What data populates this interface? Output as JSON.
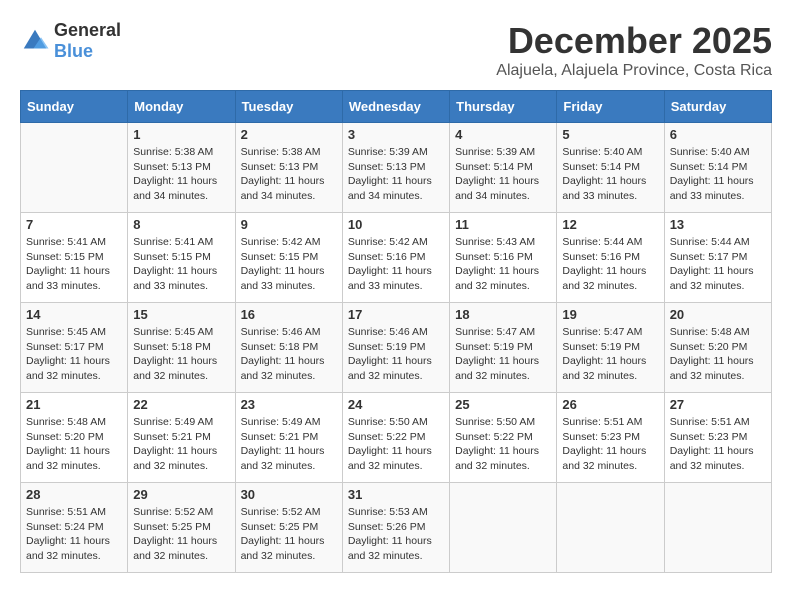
{
  "logo": {
    "text_general": "General",
    "text_blue": "Blue"
  },
  "title": "December 2025",
  "subtitle": "Alajuela, Alajuela Province, Costa Rica",
  "weekdays": [
    "Sunday",
    "Monday",
    "Tuesday",
    "Wednesday",
    "Thursday",
    "Friday",
    "Saturday"
  ],
  "weeks": [
    [
      {
        "day": "",
        "sunrise": "",
        "sunset": "",
        "daylight": ""
      },
      {
        "day": "1",
        "sunrise": "Sunrise: 5:38 AM",
        "sunset": "Sunset: 5:13 PM",
        "daylight": "Daylight: 11 hours and 34 minutes."
      },
      {
        "day": "2",
        "sunrise": "Sunrise: 5:38 AM",
        "sunset": "Sunset: 5:13 PM",
        "daylight": "Daylight: 11 hours and 34 minutes."
      },
      {
        "day": "3",
        "sunrise": "Sunrise: 5:39 AM",
        "sunset": "Sunset: 5:13 PM",
        "daylight": "Daylight: 11 hours and 34 minutes."
      },
      {
        "day": "4",
        "sunrise": "Sunrise: 5:39 AM",
        "sunset": "Sunset: 5:14 PM",
        "daylight": "Daylight: 11 hours and 34 minutes."
      },
      {
        "day": "5",
        "sunrise": "Sunrise: 5:40 AM",
        "sunset": "Sunset: 5:14 PM",
        "daylight": "Daylight: 11 hours and 33 minutes."
      },
      {
        "day": "6",
        "sunrise": "Sunrise: 5:40 AM",
        "sunset": "Sunset: 5:14 PM",
        "daylight": "Daylight: 11 hours and 33 minutes."
      }
    ],
    [
      {
        "day": "7",
        "sunrise": "Sunrise: 5:41 AM",
        "sunset": "Sunset: 5:15 PM",
        "daylight": "Daylight: 11 hours and 33 minutes."
      },
      {
        "day": "8",
        "sunrise": "Sunrise: 5:41 AM",
        "sunset": "Sunset: 5:15 PM",
        "daylight": "Daylight: 11 hours and 33 minutes."
      },
      {
        "day": "9",
        "sunrise": "Sunrise: 5:42 AM",
        "sunset": "Sunset: 5:15 PM",
        "daylight": "Daylight: 11 hours and 33 minutes."
      },
      {
        "day": "10",
        "sunrise": "Sunrise: 5:42 AM",
        "sunset": "Sunset: 5:16 PM",
        "daylight": "Daylight: 11 hours and 33 minutes."
      },
      {
        "day": "11",
        "sunrise": "Sunrise: 5:43 AM",
        "sunset": "Sunset: 5:16 PM",
        "daylight": "Daylight: 11 hours and 32 minutes."
      },
      {
        "day": "12",
        "sunrise": "Sunrise: 5:44 AM",
        "sunset": "Sunset: 5:16 PM",
        "daylight": "Daylight: 11 hours and 32 minutes."
      },
      {
        "day": "13",
        "sunrise": "Sunrise: 5:44 AM",
        "sunset": "Sunset: 5:17 PM",
        "daylight": "Daylight: 11 hours and 32 minutes."
      }
    ],
    [
      {
        "day": "14",
        "sunrise": "Sunrise: 5:45 AM",
        "sunset": "Sunset: 5:17 PM",
        "daylight": "Daylight: 11 hours and 32 minutes."
      },
      {
        "day": "15",
        "sunrise": "Sunrise: 5:45 AM",
        "sunset": "Sunset: 5:18 PM",
        "daylight": "Daylight: 11 hours and 32 minutes."
      },
      {
        "day": "16",
        "sunrise": "Sunrise: 5:46 AM",
        "sunset": "Sunset: 5:18 PM",
        "daylight": "Daylight: 11 hours and 32 minutes."
      },
      {
        "day": "17",
        "sunrise": "Sunrise: 5:46 AM",
        "sunset": "Sunset: 5:19 PM",
        "daylight": "Daylight: 11 hours and 32 minutes."
      },
      {
        "day": "18",
        "sunrise": "Sunrise: 5:47 AM",
        "sunset": "Sunset: 5:19 PM",
        "daylight": "Daylight: 11 hours and 32 minutes."
      },
      {
        "day": "19",
        "sunrise": "Sunrise: 5:47 AM",
        "sunset": "Sunset: 5:19 PM",
        "daylight": "Daylight: 11 hours and 32 minutes."
      },
      {
        "day": "20",
        "sunrise": "Sunrise: 5:48 AM",
        "sunset": "Sunset: 5:20 PM",
        "daylight": "Daylight: 11 hours and 32 minutes."
      }
    ],
    [
      {
        "day": "21",
        "sunrise": "Sunrise: 5:48 AM",
        "sunset": "Sunset: 5:20 PM",
        "daylight": "Daylight: 11 hours and 32 minutes."
      },
      {
        "day": "22",
        "sunrise": "Sunrise: 5:49 AM",
        "sunset": "Sunset: 5:21 PM",
        "daylight": "Daylight: 11 hours and 32 minutes."
      },
      {
        "day": "23",
        "sunrise": "Sunrise: 5:49 AM",
        "sunset": "Sunset: 5:21 PM",
        "daylight": "Daylight: 11 hours and 32 minutes."
      },
      {
        "day": "24",
        "sunrise": "Sunrise: 5:50 AM",
        "sunset": "Sunset: 5:22 PM",
        "daylight": "Daylight: 11 hours and 32 minutes."
      },
      {
        "day": "25",
        "sunrise": "Sunrise: 5:50 AM",
        "sunset": "Sunset: 5:22 PM",
        "daylight": "Daylight: 11 hours and 32 minutes."
      },
      {
        "day": "26",
        "sunrise": "Sunrise: 5:51 AM",
        "sunset": "Sunset: 5:23 PM",
        "daylight": "Daylight: 11 hours and 32 minutes."
      },
      {
        "day": "27",
        "sunrise": "Sunrise: 5:51 AM",
        "sunset": "Sunset: 5:23 PM",
        "daylight": "Daylight: 11 hours and 32 minutes."
      }
    ],
    [
      {
        "day": "28",
        "sunrise": "Sunrise: 5:51 AM",
        "sunset": "Sunset: 5:24 PM",
        "daylight": "Daylight: 11 hours and 32 minutes."
      },
      {
        "day": "29",
        "sunrise": "Sunrise: 5:52 AM",
        "sunset": "Sunset: 5:25 PM",
        "daylight": "Daylight: 11 hours and 32 minutes."
      },
      {
        "day": "30",
        "sunrise": "Sunrise: 5:52 AM",
        "sunset": "Sunset: 5:25 PM",
        "daylight": "Daylight: 11 hours and 32 minutes."
      },
      {
        "day": "31",
        "sunrise": "Sunrise: 5:53 AM",
        "sunset": "Sunset: 5:26 PM",
        "daylight": "Daylight: 11 hours and 32 minutes."
      },
      {
        "day": "",
        "sunrise": "",
        "sunset": "",
        "daylight": ""
      },
      {
        "day": "",
        "sunrise": "",
        "sunset": "",
        "daylight": ""
      },
      {
        "day": "",
        "sunrise": "",
        "sunset": "",
        "daylight": ""
      }
    ]
  ]
}
